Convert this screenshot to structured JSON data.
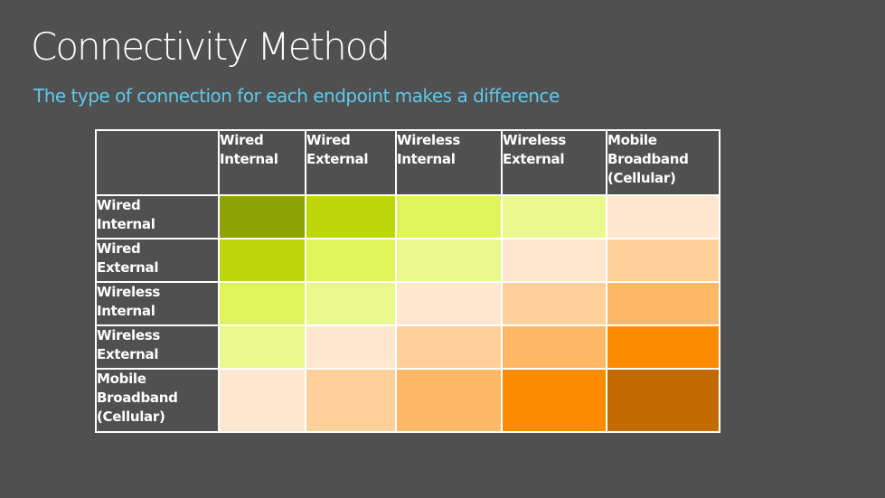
{
  "title": "Connectivity Method",
  "subtitle": "The type of connection for each endpoint makes a difference",
  "matrix": {
    "columns": [
      [
        "Wired",
        "Internal"
      ],
      [
        "Wired",
        "External"
      ],
      [
        "Wireless",
        "Internal"
      ],
      [
        "Wireless",
        "External"
      ],
      [
        "Mobile",
        "Broadband",
        "(Cellular)"
      ]
    ],
    "rows": [
      [
        "Wired",
        "Internal"
      ],
      [
        "Wired",
        "External"
      ],
      [
        "Wireless",
        "Internal"
      ],
      [
        "Wireless",
        "External"
      ],
      [
        "Mobile",
        "Broadband",
        "(Cellular)"
      ]
    ],
    "palette": [
      "#8DA304",
      "#BDD80A",
      "#DFF458",
      "#EAF98E",
      "#FFE8CF",
      "#FFD09A",
      "#FFB966",
      "#FF8C00",
      "#C26A00"
    ],
    "levels": [
      [
        0,
        1,
        2,
        3,
        4
      ],
      [
        1,
        2,
        3,
        4,
        5
      ],
      [
        2,
        3,
        4,
        5,
        6
      ],
      [
        3,
        4,
        5,
        6,
        7
      ],
      [
        4,
        5,
        6,
        7,
        8
      ]
    ]
  },
  "colors": {
    "background": "#505050",
    "title": "#FFFFFF",
    "subtitle": "#5FC8E8",
    "grid_line": "#FFFFFF"
  }
}
